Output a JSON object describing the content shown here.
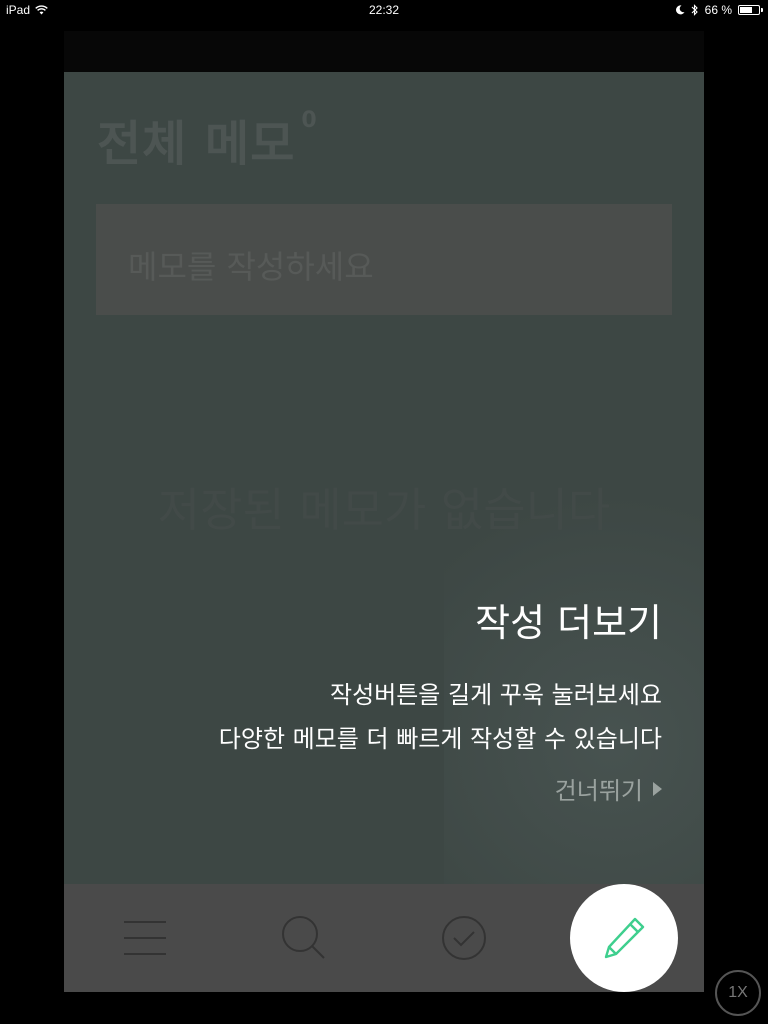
{
  "status_bar": {
    "device": "iPad",
    "time": "22:32",
    "battery": "66 %",
    "battery_level": 0.66
  },
  "main": {
    "title": "전체 메모",
    "count": "0",
    "memo_placeholder": "메모를 작성하세요",
    "empty_message": "저장된 메모가 없습니다"
  },
  "tutorial": {
    "title": "작성 더보기",
    "line1": "작성버튼을 길게 꾸욱 눌러보세요",
    "line2": "다양한 메모를 더 빠르게 작성할 수 있습니다",
    "skip_label": "건너뛰기"
  },
  "tabbar": {
    "items": [
      {
        "icon": "menu-icon"
      },
      {
        "icon": "search-icon"
      },
      {
        "icon": "check-circle-icon"
      }
    ],
    "fab_icon": "pencil-icon",
    "accent_color": "#3ecf8e"
  },
  "zoom": {
    "label": "1X"
  }
}
